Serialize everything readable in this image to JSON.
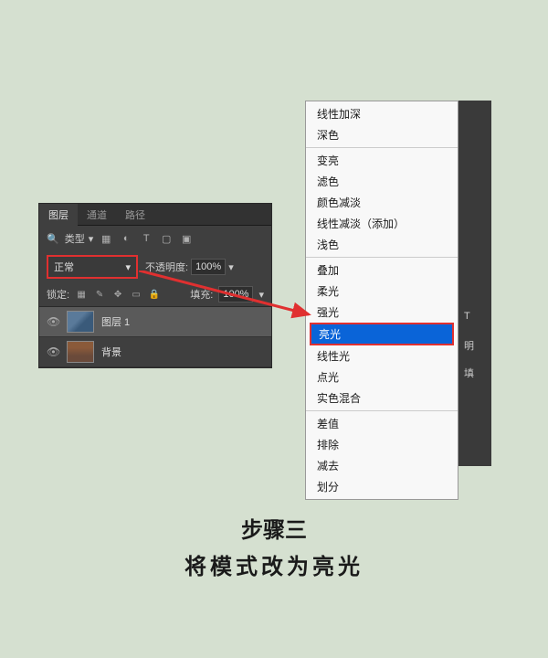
{
  "panel": {
    "tabs": [
      "图层",
      "通道",
      "路径"
    ],
    "filter_label": "类型",
    "blend_mode": "正常",
    "opacity_label": "不透明度:",
    "opacity_value": "100%",
    "lock_label": "锁定:",
    "fill_label": "填充:",
    "fill_value": "100%",
    "layers": [
      {
        "name": "图层 1"
      },
      {
        "name": "背景"
      }
    ]
  },
  "menu": {
    "groups": [
      [
        "线性加深",
        "深色"
      ],
      [
        "变亮",
        "滤色",
        "颜色减淡",
        "线性减淡（添加）",
        "浅色"
      ],
      [
        "叠加",
        "柔光",
        "强光",
        "亮光",
        "线性光",
        "点光",
        "实色混合"
      ],
      [
        "差值",
        "排除",
        "减去",
        "划分"
      ]
    ],
    "highlighted": "亮光"
  },
  "right_labels": {
    "t": "T",
    "opacity": "明",
    "fill": "填"
  },
  "caption": {
    "title": "步骤三",
    "subtitle": "将模式改为亮光"
  }
}
